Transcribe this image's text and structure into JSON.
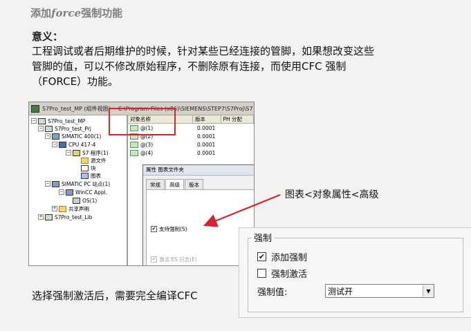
{
  "slide": {
    "title_prefix": "添加",
    "title_en": "force",
    "title_suffix": "强制功能",
    "meaning_label": "意义：",
    "meaning_text": "工程调试或者后期维护的时候，针对某些已经连接的管脚，如果想改变这些管脚的值，可以不修改原始程序，不删除原有连接，而使用CFC 强制（FORCE）功能。",
    "note": "选择强制激活后，需要完全编译CFC",
    "callout": "图表<对象属性<高级"
  },
  "screenshot": {
    "window_title": "S7Pro_test_MP (组件视图) -- C:\\Program Files (x86)\\SIEMENS\\STEP7\\S7Proj\\S7",
    "tree": [
      {
        "label": "S7Pro_test_MP",
        "icon": "project-icon"
      },
      {
        "label": "S7Pro_test_Prj",
        "icon": "project-icon"
      },
      {
        "label": "SIMATIC 400(1)",
        "icon": "station-icon"
      },
      {
        "label": "CPU 417-4",
        "icon": "cpu-icon"
      },
      {
        "label": "S7 程序(1)",
        "icon": "program-icon"
      },
      {
        "label": "源文件",
        "icon": "folder-icon"
      },
      {
        "label": "块",
        "icon": "block-icon"
      },
      {
        "label": "图表",
        "icon": "chart-icon"
      },
      {
        "label": "SIMATIC PC 站点(1)",
        "icon": "pc-station-icon"
      },
      {
        "label": "WinCC Appl.",
        "icon": "pc-station-icon"
      },
      {
        "label": "OS(1)",
        "icon": "os-icon"
      },
      {
        "label": "共享声明",
        "icon": "folder-icon"
      },
      {
        "label": "S7Pro_test_Lib",
        "icon": "library-icon"
      }
    ],
    "columns": [
      "对象名称",
      "版本",
      "PH 分配"
    ],
    "rows": [
      {
        "name": "@(1)",
        "version": "0.0001"
      },
      {
        "name": "@(2)",
        "version": "0.0001"
      },
      {
        "name": "@(3)",
        "version": "0.0001"
      },
      {
        "name": "@(4)",
        "version": "0.0001"
      }
    ],
    "dialog": {
      "title": "属性 图表文件夹",
      "tabs": [
        "常规",
        "高级",
        "版本"
      ],
      "support_force": "支持强制(S)",
      "es_log": "激活 ES 日志(E)"
    }
  },
  "force_panel": {
    "group_label": "强制",
    "add_force": "添加强制",
    "activate_force": "强制激活",
    "force_value_label": "强制值:",
    "force_value": "测试开"
  }
}
